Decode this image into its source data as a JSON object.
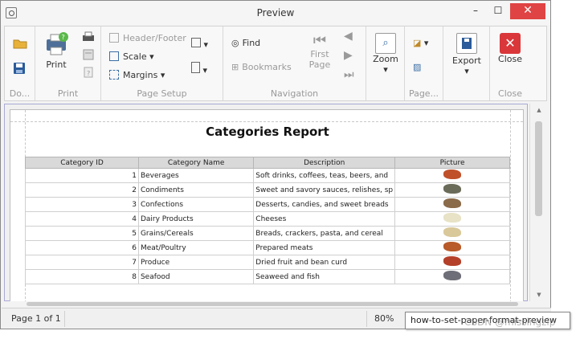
{
  "window": {
    "title": "Preview",
    "minimize": "–",
    "maximize": "☐",
    "close": "✕"
  },
  "ribbon": {
    "document": {
      "caption": "Do..."
    },
    "print": {
      "caption": "Print",
      "print_label": "Print"
    },
    "page_setup": {
      "caption": "Page Setup",
      "header_footer": "Header/Footer",
      "scale": "Scale",
      "margins": "Margins"
    },
    "navigation": {
      "caption": "Navigation",
      "find": "Find",
      "bookmarks": "Bookmarks",
      "first_page_line1": "First",
      "first_page_line2": "Page"
    },
    "zoom": {
      "label": "Zoom"
    },
    "page_background": {
      "caption": "Page..."
    },
    "export": {
      "label": "Export"
    },
    "close_group": {
      "caption": "Close",
      "label": "Close"
    }
  },
  "report": {
    "title": "Categories Report",
    "columns": [
      "Category ID",
      "Category Name",
      "Description",
      "Picture"
    ],
    "rows": [
      {
        "id": "1",
        "name": "Beverages",
        "desc": "Soft drinks, coffees, teas, beers, and",
        "pic_color": "#c0502a"
      },
      {
        "id": "2",
        "name": "Condiments",
        "desc": "Sweet and savory sauces, relishes, sp",
        "pic_color": "#6b6b5a"
      },
      {
        "id": "3",
        "name": "Confections",
        "desc": "Desserts, candies, and sweet breads",
        "pic_color": "#8a6b4a"
      },
      {
        "id": "4",
        "name": "Dairy Products",
        "desc": "Cheeses",
        "pic_color": "#e8e2c6"
      },
      {
        "id": "5",
        "name": "Grains/Cereals",
        "desc": "Breads, crackers, pasta, and cereal",
        "pic_color": "#d9c89a"
      },
      {
        "id": "6",
        "name": "Meat/Poultry",
        "desc": "Prepared meats",
        "pic_color": "#b85a2a"
      },
      {
        "id": "7",
        "name": "Produce",
        "desc": "Dried fruit and bean curd",
        "pic_color": "#b4402a"
      },
      {
        "id": "8",
        "name": "Seafood",
        "desc": "Seaweed and fish",
        "pic_color": "#6e6e78"
      }
    ]
  },
  "status": {
    "page": "Page 1 of 1",
    "zoom": "80%"
  },
  "tooltip": "how-to-set-paper-format-preview",
  "watermark": "CSDN @missingzip",
  "colors": {
    "accent_close": "#e04343",
    "selection_border": "#a9a9d6"
  }
}
